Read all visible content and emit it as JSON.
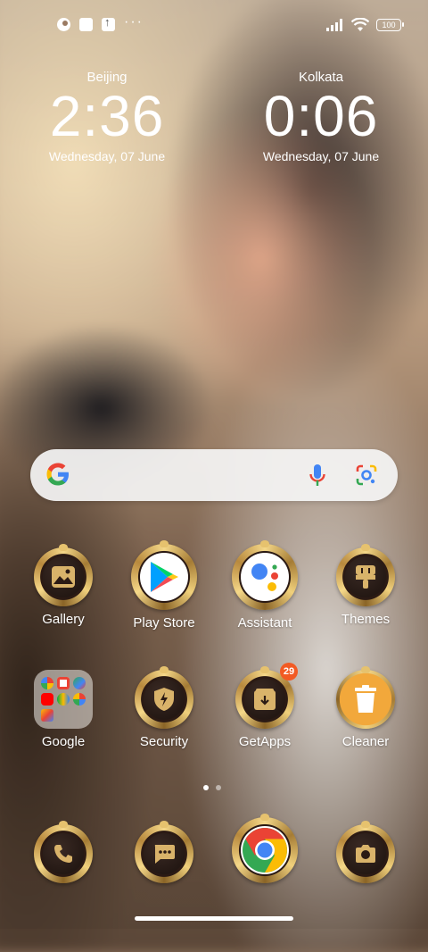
{
  "status_bar": {
    "left_icons": [
      "notification-app-icon",
      "notification-square-icon",
      "upload-icon"
    ],
    "more": "···",
    "right_icons": [
      "signal-icon",
      "wifi-icon"
    ],
    "battery": "100"
  },
  "clocks": [
    {
      "city": "Beijing",
      "time": "2:36",
      "date": "Wednesday, 07 June"
    },
    {
      "city": "Kolkata",
      "time": "0:06",
      "date": "Wednesday, 07 June"
    }
  ],
  "search": {
    "icons": [
      "google-g-icon",
      "microphone-icon",
      "google-lens-icon"
    ]
  },
  "apps": {
    "row1": [
      {
        "label": "Gallery",
        "icon": "gallery-icon"
      },
      {
        "label": "Play Store",
        "icon": "play-store-icon"
      },
      {
        "label": "Assistant",
        "icon": "assistant-icon"
      },
      {
        "label": "Themes",
        "icon": "themes-icon"
      }
    ],
    "row2": [
      {
        "label": "Google",
        "icon": "google-folder-icon"
      },
      {
        "label": "Security",
        "icon": "security-icon"
      },
      {
        "label": "GetApps",
        "icon": "getapps-icon",
        "badge": "29"
      },
      {
        "label": "Cleaner",
        "icon": "cleaner-icon"
      }
    ]
  },
  "dock": [
    {
      "icon": "phone-icon"
    },
    {
      "icon": "messages-icon"
    },
    {
      "icon": "chrome-icon"
    },
    {
      "icon": "camera-icon"
    }
  ],
  "page_indicator": {
    "pages": 2,
    "active": 1
  }
}
